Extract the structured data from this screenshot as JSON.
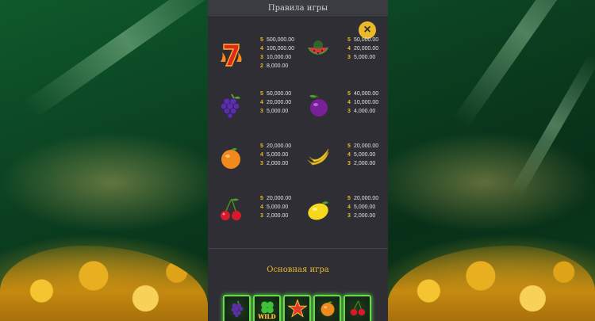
{
  "panel": {
    "title": "Правила игры",
    "close_icon": "×"
  },
  "paytable": [
    {
      "symbol": "seven",
      "icon": "seven-icon",
      "pays": [
        {
          "count": "5",
          "value": "500,000.00"
        },
        {
          "count": "4",
          "value": "100,000.00"
        },
        {
          "count": "3",
          "value": "10,000.00"
        },
        {
          "count": "2",
          "value": "8,000.00"
        }
      ]
    },
    {
      "symbol": "watermelon",
      "icon": "watermelon-icon",
      "pays": [
        {
          "count": "5",
          "value": "50,000.00"
        },
        {
          "count": "4",
          "value": "20,000.00"
        },
        {
          "count": "3",
          "value": "5,000.00"
        }
      ]
    },
    {
      "symbol": "grapes",
      "icon": "grapes-icon",
      "pays": [
        {
          "count": "5",
          "value": "50,000.00"
        },
        {
          "count": "4",
          "value": "20,000.00"
        },
        {
          "count": "3",
          "value": "5,000.00"
        }
      ]
    },
    {
      "symbol": "plum",
      "icon": "plum-icon",
      "pays": [
        {
          "count": "5",
          "value": "40,000.00"
        },
        {
          "count": "4",
          "value": "10,000.00"
        },
        {
          "count": "3",
          "value": "4,000.00"
        }
      ]
    },
    {
      "symbol": "orange",
      "icon": "orange-icon",
      "pays": [
        {
          "count": "5",
          "value": "20,000.00"
        },
        {
          "count": "4",
          "value": "5,000.00"
        },
        {
          "count": "3",
          "value": "2,000.00"
        }
      ]
    },
    {
      "symbol": "bananas",
      "icon": "banana-icon",
      "pays": [
        {
          "count": "5",
          "value": "20,000.00"
        },
        {
          "count": "4",
          "value": "5,000.00"
        },
        {
          "count": "3",
          "value": "2,000.00"
        }
      ]
    },
    {
      "symbol": "cherries",
      "icon": "cherry-icon",
      "pays": [
        {
          "count": "5",
          "value": "20,000.00"
        },
        {
          "count": "4",
          "value": "5,000.00"
        },
        {
          "count": "3",
          "value": "2,000.00"
        }
      ]
    },
    {
      "symbol": "lemon",
      "icon": "lemon-icon",
      "pays": [
        {
          "count": "5",
          "value": "20,000.00"
        },
        {
          "count": "4",
          "value": "5,000.00"
        },
        {
          "count": "3",
          "value": "2,000.00"
        }
      ]
    }
  ],
  "main_game": {
    "title": "Основная игра",
    "reel": [
      {
        "icon": "grapes-icon"
      },
      {
        "icon": "clover-wild-icon",
        "label": "WILD"
      },
      {
        "icon": "star-icon"
      },
      {
        "icon": "orange-icon"
      },
      {
        "icon": "cherry-icon"
      }
    ]
  },
  "colors": {
    "panel_bg": "#2e2e34",
    "accent_gold": "#e9b92a",
    "reel_glow": "#67d94a"
  }
}
